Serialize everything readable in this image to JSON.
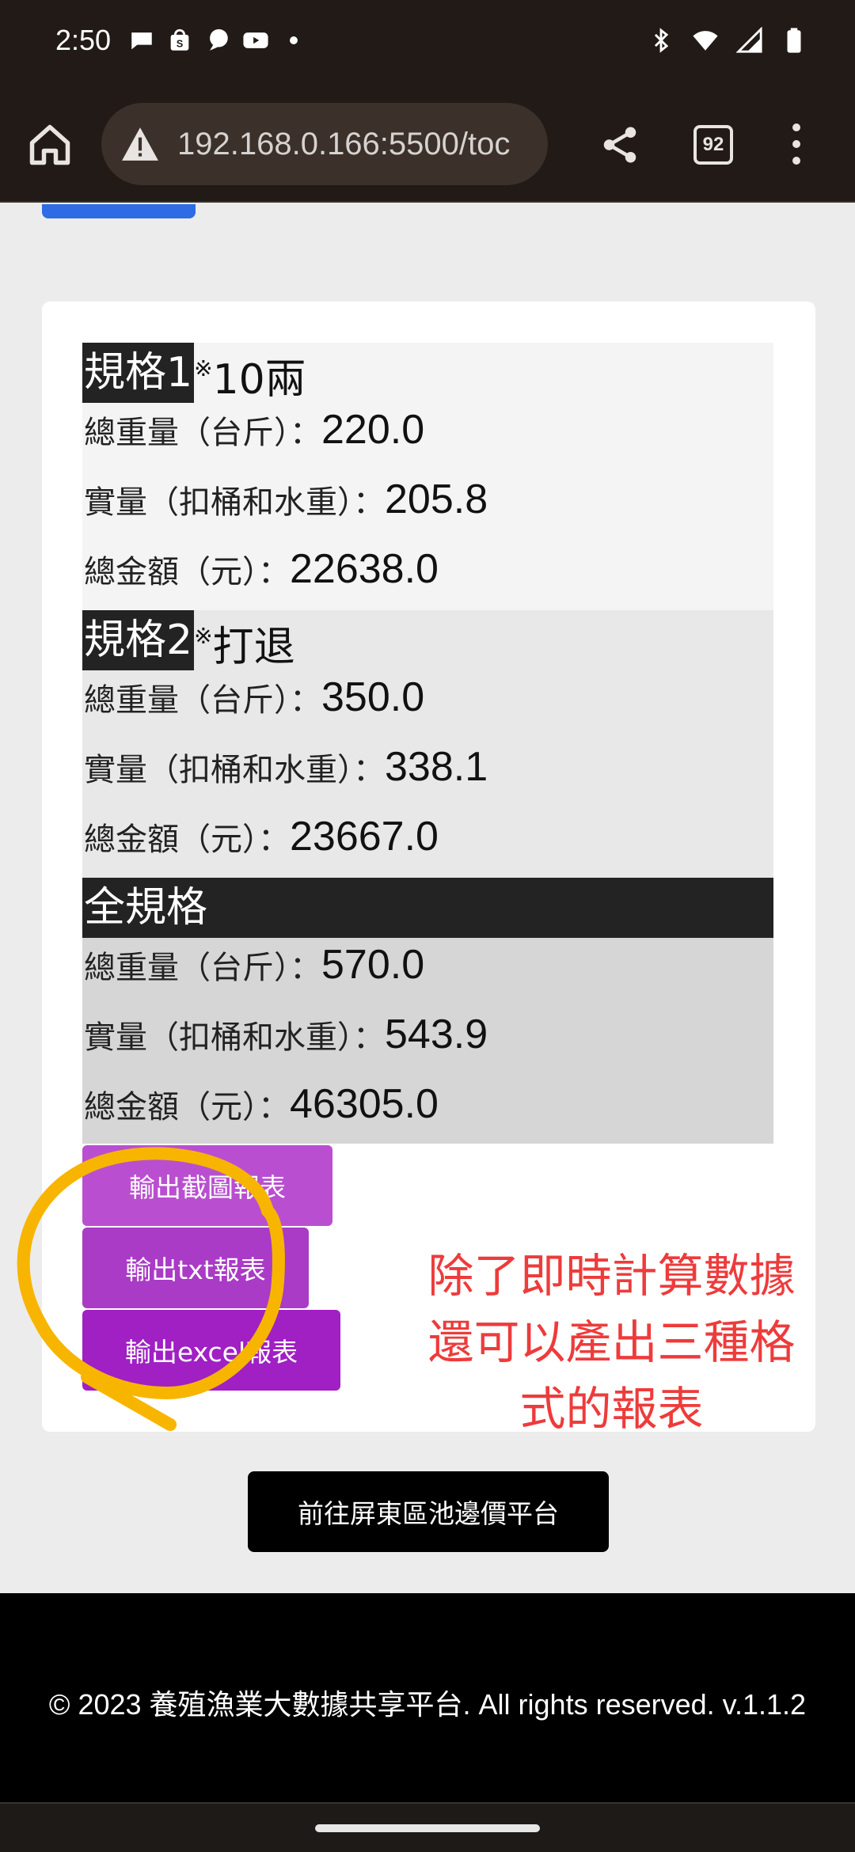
{
  "status_bar": {
    "time": "2:50",
    "icons_left": [
      "chat-bubble-icon",
      "shopping-bag-icon",
      "message-icon",
      "youtube-icon",
      "dot-icon"
    ],
    "icons_right": [
      "bluetooth-icon",
      "wifi-icon",
      "signal-icon",
      "battery-icon"
    ]
  },
  "browser": {
    "url": "192.168.0.166:5500/toc",
    "tab_count": "92"
  },
  "specs": [
    {
      "name": "規格1",
      "note_mark": "※",
      "note": "10兩",
      "total_weight_label": "總重量（台斤）：",
      "total_weight": "220.0",
      "net_weight_label": "實量（扣桶和水重）：",
      "net_weight": "205.8",
      "total_amount_label": "總金額（元）：",
      "total_amount": "22638.0"
    },
    {
      "name": "規格2",
      "note_mark": "※",
      "note": "打退",
      "total_weight_label": "總重量（台斤）：",
      "total_weight": "350.0",
      "net_weight_label": "實量（扣桶和水重）：",
      "net_weight": "338.1",
      "total_amount_label": "總金額（元）：",
      "total_amount": "23667.0"
    }
  ],
  "all_specs": {
    "title": "全規格",
    "total_weight_label": "總重量（台斤）：",
    "total_weight": "570.0",
    "net_weight_label": "實量（扣桶和水重）：",
    "net_weight": "543.9",
    "total_amount_label": "總金額（元）：",
    "total_amount": "46305.0"
  },
  "export_buttons": {
    "screenshot": "輸出截圖報表",
    "txt": "輸出txt報表",
    "excel": "輸出excel報表"
  },
  "annotation": {
    "line1": "除了即時計算數據",
    "line2": "還可以產出三種格",
    "line3": "式的報表",
    "color": "#ee3b3b",
    "circle_color": "#f7b500"
  },
  "nav_button": "前往屏東區池邊價平台",
  "footer": "© 2023 養殖漁業大數據共享平台. All rights reserved. v.1.1.2",
  "colors": {
    "browser_chrome": "#221a16",
    "spec_header": "#232323",
    "btn_screenshot": "#b94fd0",
    "btn_txt": "#a93bc6",
    "btn_excel": "#a020c4",
    "link_blue": "#2f6be5"
  }
}
